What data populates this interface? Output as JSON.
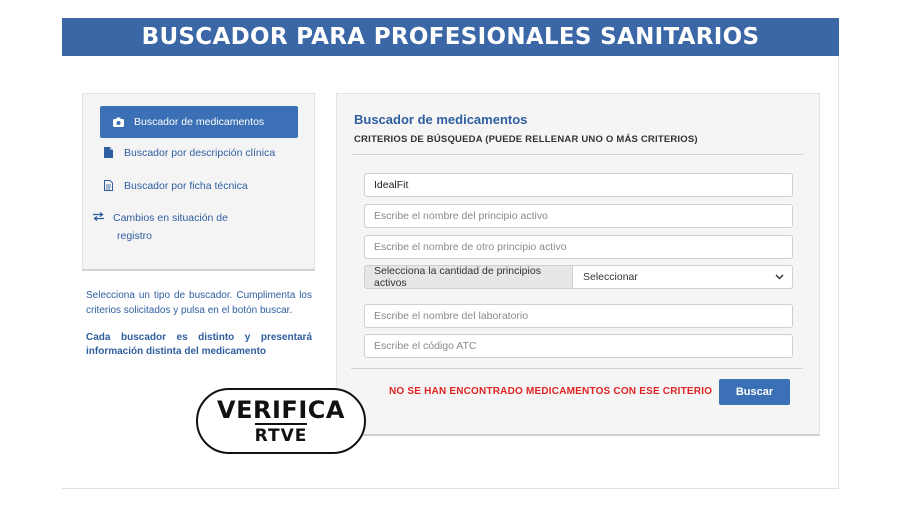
{
  "header": {
    "title": "BUSCADOR PARA PROFESIONALES SANITARIOS"
  },
  "sidebar": {
    "items": [
      {
        "label": "Buscador de medicamentos",
        "icon": "camera-icon",
        "active": true
      },
      {
        "label": "Buscador por descripción clínica",
        "icon": "document-icon"
      },
      {
        "label": "Buscador por ficha técnica",
        "icon": "document-lines-icon"
      },
      {
        "label": "Cambios en situación de registro",
        "icon": "exchange-arrows-icon"
      }
    ],
    "help_text": "Selecciona un tipo de buscador. Cumplimenta los criterios solicitados y pulsa en el botón buscar.",
    "help_strong": "Cada buscador es distinto y presentará información distinta del medicamento"
  },
  "logo": {
    "line1": "VERIFICA",
    "line2": "RTVE"
  },
  "panel": {
    "title": "Buscador de medicamentos",
    "subtitle": "CRITERIOS DE BÚSQUEDA (PUEDE RELLENAR UNO O MÁS CRITERIOS)",
    "fields": {
      "name_value": "IdealFit",
      "principio_activo_placeholder": "Escribe el nombre del principio activo",
      "otro_principio_placeholder": "Escribe el nombre de otro principio activo",
      "laboratorio_placeholder": "Escribe el nombre del laboratorio",
      "atc_placeholder": "Escribe el código ATC"
    },
    "select": {
      "label": "Selecciona la cantidad de principios activos",
      "selected": "Seleccionar"
    },
    "error": "NO SE HAN ENCONTRADO MEDICAMENTOS CON ESE CRITERIO",
    "search_label": "Buscar"
  },
  "colors": {
    "brand_blue": "#3b67a6",
    "button_blue": "#3b70b6",
    "link_blue": "#2f5ea0",
    "error_red": "#e02424"
  }
}
